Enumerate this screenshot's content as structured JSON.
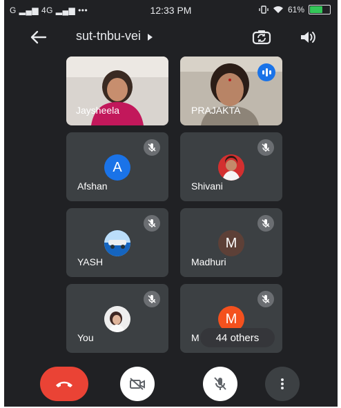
{
  "status": {
    "left_text": "G ▂▄▆ 4G ▂▄▆ •••",
    "time": "12:33 PM",
    "battery_text": "61%",
    "battery_level": 0.61
  },
  "header": {
    "meeting_code": "sut-tnbu-vei"
  },
  "participants": [
    {
      "name": "Jaysheela",
      "type": "video"
    },
    {
      "name": "PRAJAKTA",
      "type": "video",
      "speaking": true
    },
    {
      "name": "Afshan",
      "type": "initial",
      "initial": "A",
      "color": "#1a73e8",
      "muted": true
    },
    {
      "name": "Shivani",
      "type": "photo",
      "muted": true
    },
    {
      "name": "YASH",
      "type": "photo",
      "muted": true
    },
    {
      "name": "Madhuri",
      "type": "initial",
      "initial": "M",
      "color": "#5d4037",
      "muted": true
    },
    {
      "name": "You",
      "type": "photo",
      "muted": true
    },
    {
      "name": "M",
      "type": "initial",
      "initial": "M",
      "color": "#f4511e",
      "muted": true
    }
  ],
  "overlay": {
    "others_label": "44 others"
  },
  "colors": {
    "end_call": "#ea4335",
    "speaking": "#1a73e8",
    "background": "#202124"
  },
  "icons": {
    "back": "arrow-left-icon",
    "flip_camera": "camera-flip-icon",
    "speaker": "speaker-icon",
    "muted": "mic-off-icon",
    "end_call": "phone-end-icon",
    "camera": "camera-off-icon",
    "mic": "mic-off-icon",
    "more": "more-vertical-icon"
  }
}
